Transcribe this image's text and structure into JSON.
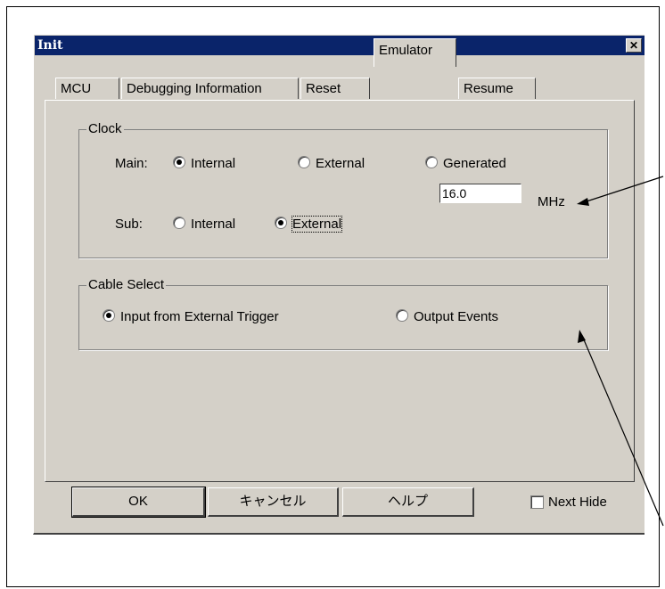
{
  "window": {
    "title": "Init",
    "close_label": "✕"
  },
  "tabs": [
    {
      "label": "MCU"
    },
    {
      "label": "Debugging Information"
    },
    {
      "label": "Reset"
    },
    {
      "label": "Emulator"
    },
    {
      "label": "Resume"
    }
  ],
  "clock": {
    "group_label": "Clock",
    "main_label": "Main:",
    "main_options": [
      "Internal",
      "External",
      "Generated"
    ],
    "main_selected": "Internal",
    "frequency_value": "16.0",
    "frequency_unit": "MHz",
    "sub_label": "Sub:",
    "sub_options": [
      "Internal",
      "External"
    ],
    "sub_selected": "External"
  },
  "cable_select": {
    "group_label": "Cable Select",
    "options": [
      "Input from External Trigger",
      "Output Events"
    ],
    "selected": "Input from External Trigger"
  },
  "buttons": {
    "ok": "OK",
    "cancel": "キャンセル",
    "help": "ヘルプ"
  },
  "next_hide": {
    "label": "Next Hide",
    "checked": false
  }
}
